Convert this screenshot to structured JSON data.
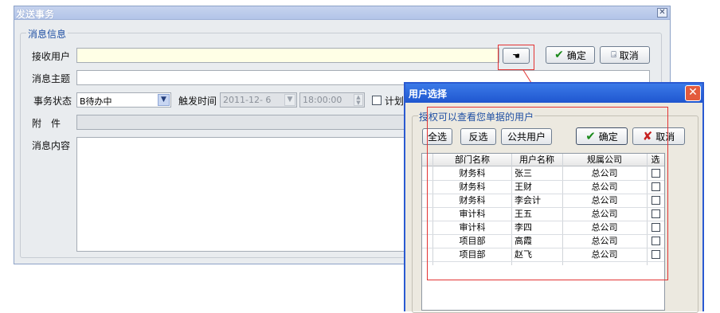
{
  "main_window": {
    "title": "发送事务",
    "group_caption": "消息信息",
    "fields": {
      "recipient_label": "接收用户",
      "subject_label": "消息主题",
      "status_label": "事务状态",
      "status_value": "B待办中",
      "trigger_label": "触发时间",
      "trigger_date": "2011-12- 6",
      "trigger_time": "18:00:00",
      "plan_label": "计划",
      "attach_label": "附　件",
      "content_label": "消息内容"
    },
    "buttons": {
      "ok": "确定",
      "cancel": "取消"
    }
  },
  "user_dialog": {
    "title": "用户选择",
    "group_caption": "授权可以查看您单据的用户",
    "buttons": {
      "select_all": "全选",
      "invert": "反选",
      "public_users": "公共用户",
      "ok": "确定",
      "cancel": "取消"
    },
    "columns": [
      "部门名称",
      "用户名称",
      "规属公司",
      "选"
    ],
    "rows": [
      {
        "dept": "财务科",
        "user": "张三",
        "company": "总公司"
      },
      {
        "dept": "财务科",
        "user": "王财",
        "company": "总公司"
      },
      {
        "dept": "财务科",
        "user": "李会计",
        "company": "总公司"
      },
      {
        "dept": "审计科",
        "user": "王五",
        "company": "总公司"
      },
      {
        "dept": "审计科",
        "user": "李四",
        "company": "总公司"
      },
      {
        "dept": "项目部",
        "user": "高霞",
        "company": "总公司"
      },
      {
        "dept": "项目部",
        "user": "赵飞",
        "company": "总公司"
      }
    ]
  },
  "colors": {
    "annotation_red": "#e33333",
    "dialog_title_blue": "#2b5ad1"
  }
}
